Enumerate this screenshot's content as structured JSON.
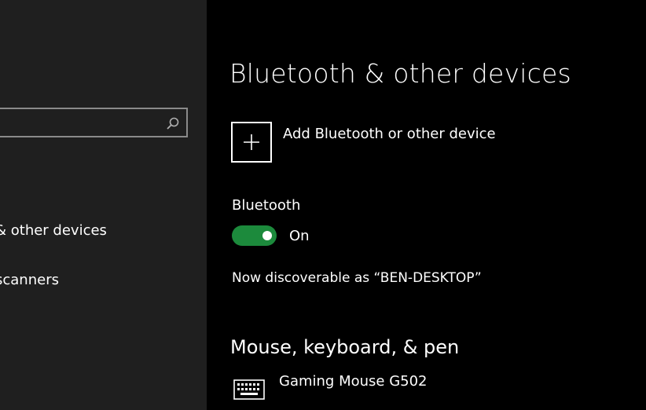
{
  "sidebar": {
    "search": {
      "value": "",
      "placeholder": "",
      "icon": "search-icon"
    },
    "items": [
      {
        "label": "& other devices"
      },
      {
        "label": "scanners"
      }
    ]
  },
  "main": {
    "title": "Bluetooth & other devices",
    "add_device": {
      "label": "Add Bluetooth or other device",
      "icon": "plus-icon"
    },
    "bluetooth": {
      "heading": "Bluetooth",
      "toggle_state": "On",
      "enabled": true,
      "discoverable_text": "Now discoverable as “BEN-DESKTOP”"
    },
    "section": {
      "title": "Mouse, keyboard, & pen",
      "devices": [
        {
          "name": "Gaming Mouse G502",
          "icon": "keyboard-icon"
        }
      ]
    }
  },
  "colors": {
    "sidebar_bg": "#1f1f1f",
    "main_bg": "#000000",
    "accent_green": "#1c8a3c"
  }
}
